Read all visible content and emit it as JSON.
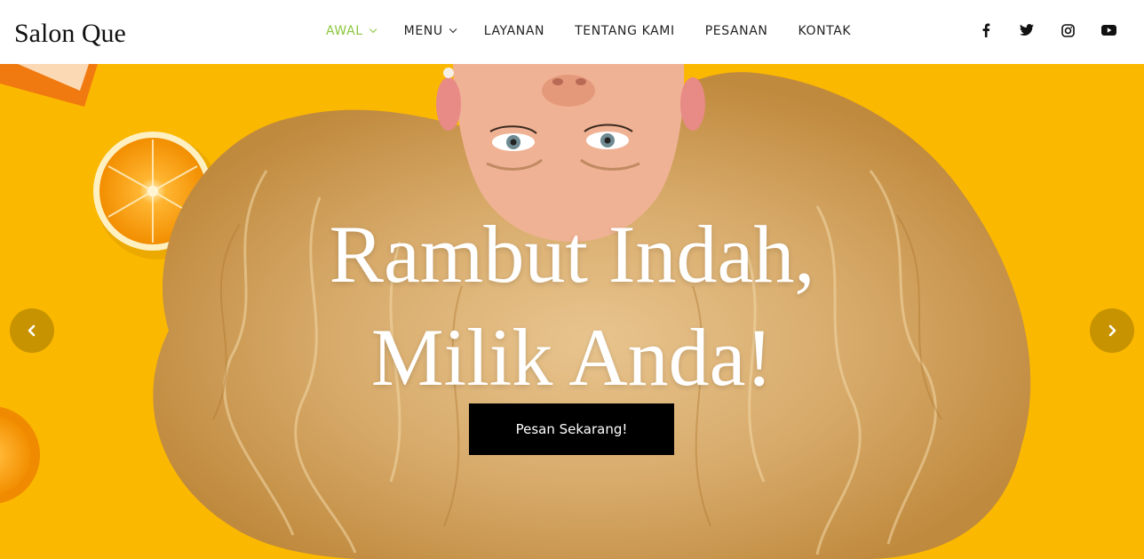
{
  "brand": {
    "name": "Salon Que"
  },
  "nav": {
    "items": [
      {
        "label": "AWAL",
        "active": true,
        "dropdown": true
      },
      {
        "label": "MENU",
        "active": false,
        "dropdown": true
      },
      {
        "label": "LAYANAN",
        "active": false,
        "dropdown": false
      },
      {
        "label": "TENTANG KAMI",
        "active": false,
        "dropdown": false
      },
      {
        "label": "PESANAN",
        "active": false,
        "dropdown": false
      },
      {
        "label": "KONTAK",
        "active": false,
        "dropdown": false
      }
    ]
  },
  "social": [
    {
      "icon": "facebook-icon"
    },
    {
      "icon": "twitter-icon"
    },
    {
      "icon": "instagram-icon"
    },
    {
      "icon": "youtube-icon"
    }
  ],
  "hero": {
    "headline_line1": "Rambut Indah,",
    "headline_line2": "Milik Anda!",
    "cta_label": "Pesan Sekarang!",
    "prev_icon": "chevron-left-icon",
    "next_icon": "chevron-right-icon"
  },
  "colors": {
    "accent": "#8cc63f",
    "hero_background": "#fbb800",
    "button": "#000000",
    "arrow": "#c08d00"
  }
}
